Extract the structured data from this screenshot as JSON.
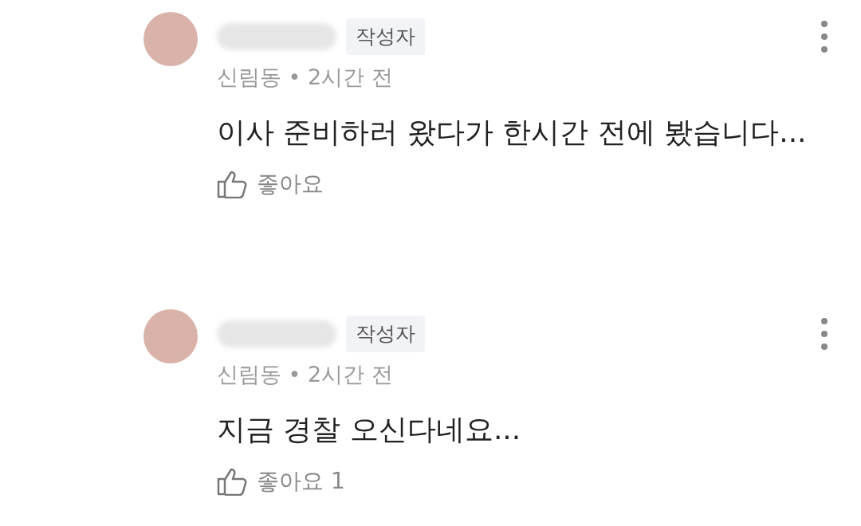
{
  "comments": [
    {
      "badge": "작성자",
      "meta": "신림동 • 2시간 전",
      "text": "이사 준비하러 왔다가 한시간 전에 봤습니다...",
      "like_label": "좋아요"
    },
    {
      "badge": "작성자",
      "meta": "신림동 • 2시간 전",
      "text": "지금 경찰 오신다네요...",
      "like_label": "좋아요",
      "like_count": "1"
    }
  ]
}
